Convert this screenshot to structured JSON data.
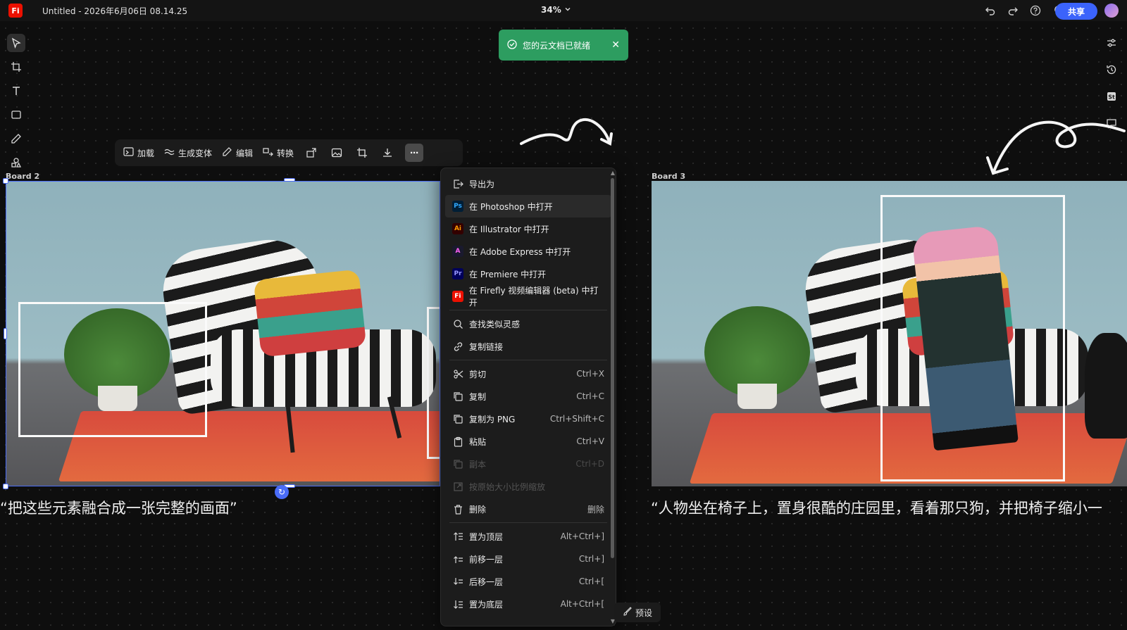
{
  "app": {
    "logo": "Fi",
    "doc_title": "Untitled - 2026年6月06日 08.14.25",
    "zoom": "34%",
    "share_label": "共享"
  },
  "top_icons": [
    "undo-icon",
    "redo-icon",
    "help-icon",
    "lightbulb-icon"
  ],
  "left_tools": [
    "select-icon",
    "crop-frame-icon",
    "text-icon",
    "rectangle-icon",
    "pen-icon",
    "shapes-icon"
  ],
  "right_tools": [
    "adjust-icon",
    "history-icon",
    "stock-icon",
    "comment-icon"
  ],
  "toast": {
    "message": "您的云文档已就绪"
  },
  "context_toolbar": {
    "load": "加载",
    "gen_variant": "生成变体",
    "edit": "编辑",
    "convert": "转换"
  },
  "boards": {
    "left_label": "Board 2",
    "right_label": "Board 3",
    "left_caption": "“把这些元素融合成一张完整的画面”",
    "right_caption": "“人物坐在椅子上，置身很酷的庄园里，看着那只狗，并把椅子缩小一"
  },
  "menu": {
    "export": "导出为",
    "apps": [
      {
        "badge": "Ps",
        "color": "#001e36",
        "fg": "#31a8ff",
        "label": "在 Photoshop 中打开"
      },
      {
        "badge": "Ai",
        "color": "#330000",
        "fg": "#ff9a00",
        "label": "在 Illustrator 中打开"
      },
      {
        "badge": "A",
        "color": "#1a1a2e",
        "fg": "#ff61f6",
        "label": "在 Adobe Express 中打开"
      },
      {
        "badge": "Pr",
        "color": "#00005b",
        "fg": "#9999ff",
        "label": "在 Premiere 中打开"
      },
      {
        "badge": "Fi",
        "color": "#eb1000",
        "fg": "#ffffff",
        "label": "在 Firefly 视频编辑器 (beta) 中打开"
      }
    ],
    "find_similar": "查找类似灵感",
    "copy_link": "复制链接",
    "cut": {
      "label": "剪切",
      "shortcut": "Ctrl+X"
    },
    "copy": {
      "label": "复制",
      "shortcut": "Ctrl+C"
    },
    "copy_png": {
      "label": "复制为 PNG",
      "shortcut": "Ctrl+Shift+C"
    },
    "paste": {
      "label": "粘贴",
      "shortcut": "Ctrl+V"
    },
    "duplicate": {
      "label": "副本",
      "shortcut": "Ctrl+D"
    },
    "scale_original": {
      "label": "按原始大小比例缩放"
    },
    "delete": {
      "label": "删除",
      "shortcut": "删除"
    },
    "bring_front": {
      "label": "置为顶层",
      "shortcut": "Alt+Ctrl+]"
    },
    "bring_forward": {
      "label": "前移一层",
      "shortcut": "Ctrl+]"
    },
    "send_backward": {
      "label": "后移一层",
      "shortcut": "Ctrl+["
    },
    "send_back": {
      "label": "置为底层",
      "shortcut": "Alt+Ctrl+["
    }
  },
  "preset_label": "预设"
}
